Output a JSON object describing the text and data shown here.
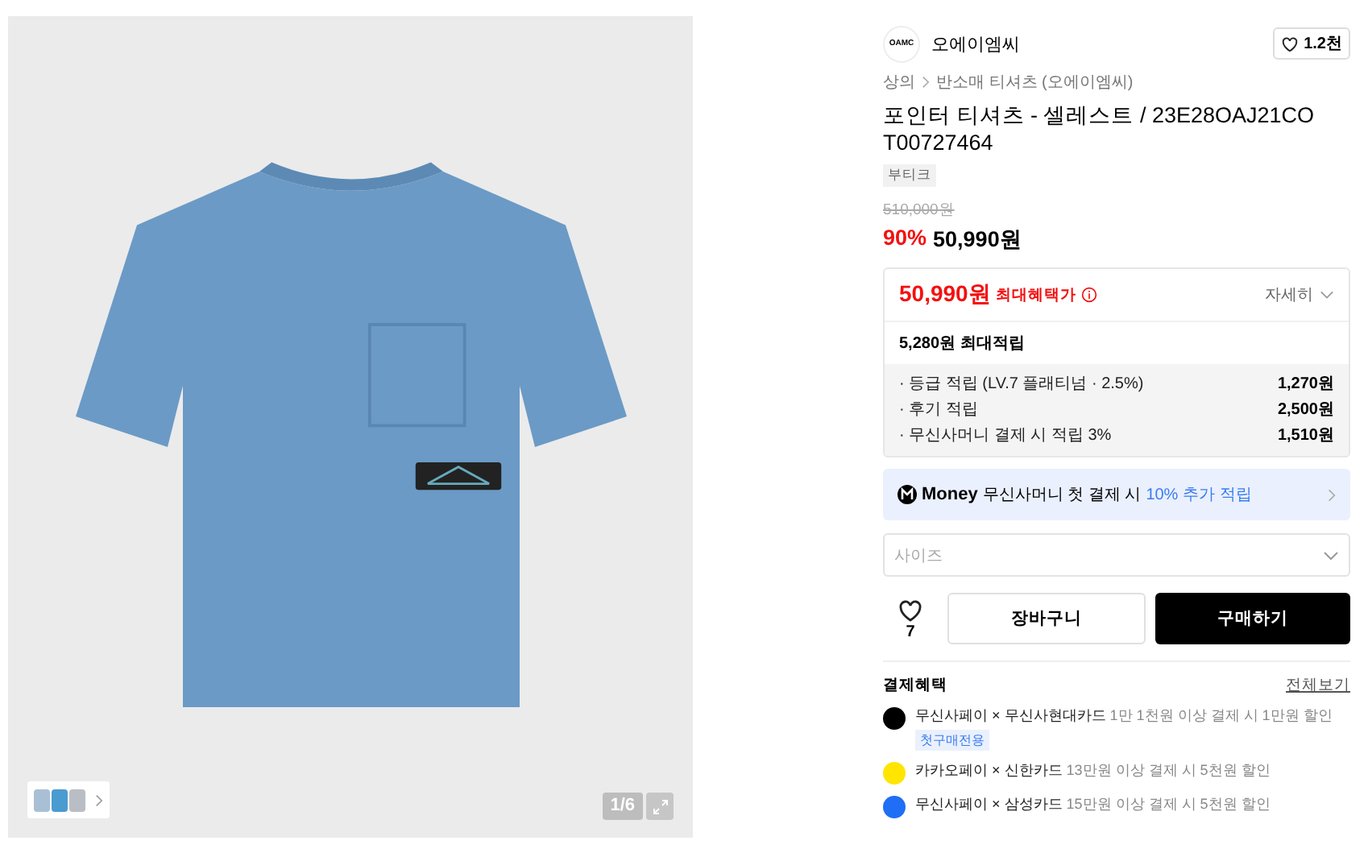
{
  "gallery": {
    "counter": "1/6"
  },
  "brand": {
    "logo_text": "OAMC",
    "name": "오에이엠씨",
    "likes": "1.2천"
  },
  "breadcrumb": [
    "상의",
    "반소매 티셔츠 (오에이엠씨)"
  ],
  "title": "포인터 티셔츠 - 셀레스트 / 23E28OAJ21COT00727464",
  "tag": "부티크",
  "original_price": "510,000원",
  "discount": "90%",
  "price": "50,990원",
  "benefit_box": {
    "price": "50,990원",
    "label": "최대혜택가",
    "detail": "자세히",
    "points_total": "5,280원 최대적립",
    "points": [
      {
        "label": "· 등급 적립 (LV.7 플래티넘 · 2.5%)",
        "amount": "1,270원"
      },
      {
        "label": "· 후기 적립",
        "amount": "2,500원"
      },
      {
        "label": "· 무신사머니 결제 시 적립 3%",
        "amount": "1,510원"
      }
    ]
  },
  "money_banner": {
    "logo": "Money",
    "text": "무신사머니 첫 결제 시",
    "highlight": "10% 추가 적립"
  },
  "size_select": {
    "placeholder": "사이즈"
  },
  "wishlist_count": "7",
  "cart_button": "장바구니",
  "buy_button": "구매하기",
  "payment_benefits": {
    "title": "결제혜택",
    "link": "전체보기",
    "items": [
      {
        "color": "#000000",
        "name": "무신사페이 × 무신사현대카드",
        "detail": "1만 1천원 이상 결제 시 1만원 할인",
        "badge": "첫구매전용"
      },
      {
        "color": "#ffe500",
        "name": "카카오페이 × 신한카드",
        "detail": "13만원 이상 결제 시 5천원 할인"
      },
      {
        "color": "#1e6ff5",
        "name": "무신사페이 × 삼성카드",
        "detail": "15만원 이상 결제 시 5천원 할인"
      }
    ]
  }
}
